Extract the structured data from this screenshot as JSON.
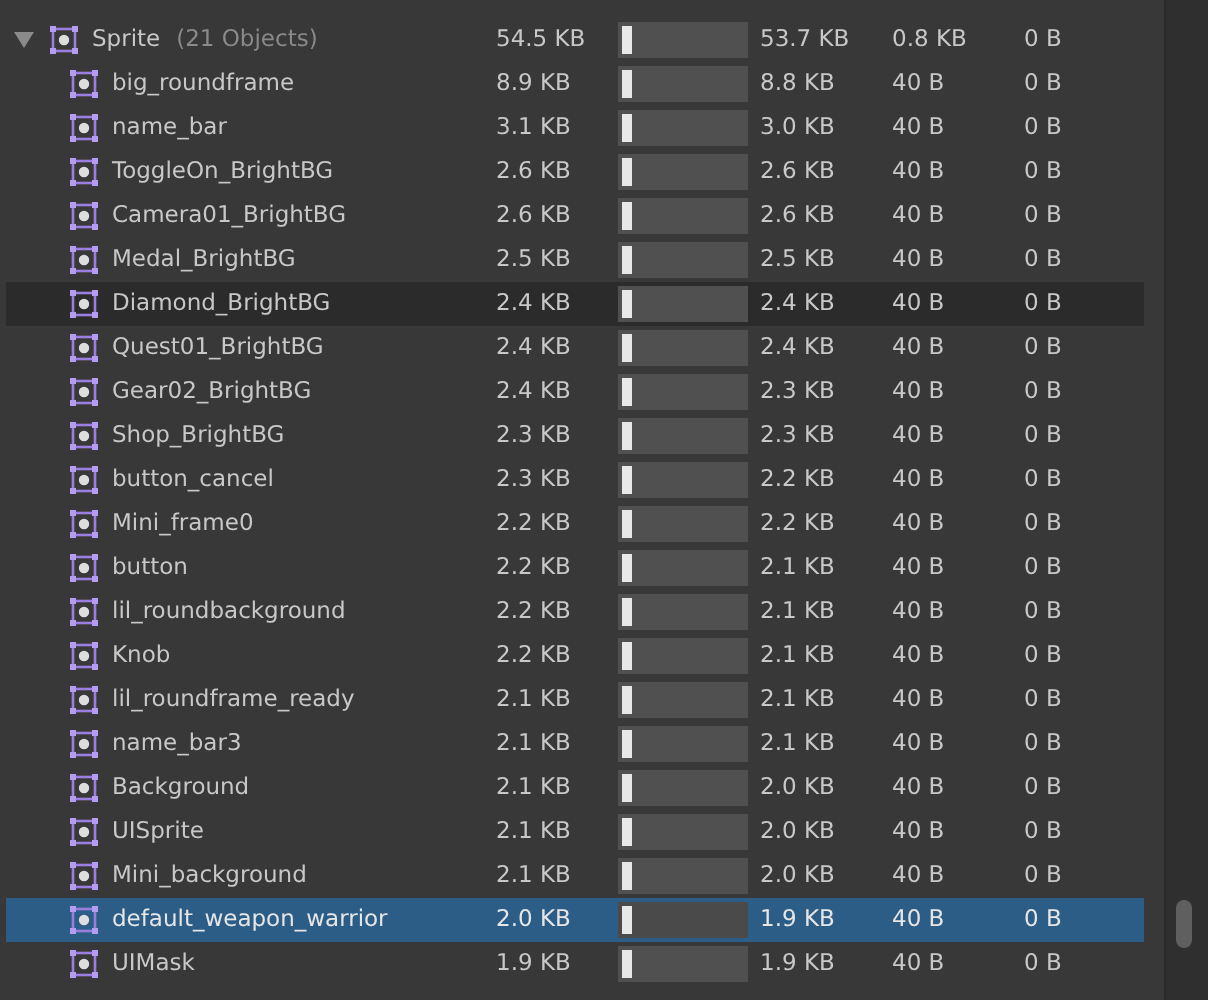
{
  "group": {
    "name": "Sprite",
    "count": "(21 Objects)",
    "expanded": true,
    "size": "54.5 KB",
    "level": 0.07,
    "col_3": "53.7 KB",
    "col_4": "0.8 KB",
    "col_5": "0 B"
  },
  "rows": [
    {
      "name": "big_roundframe",
      "size": "8.9 KB",
      "level": 0.07,
      "col_3": "8.8 KB",
      "col_4": "40 B",
      "col_5": "0 B",
      "selected": false,
      "hovered": false
    },
    {
      "name": "name_bar",
      "size": "3.1 KB",
      "level": 0.07,
      "col_3": "3.0 KB",
      "col_4": "40 B",
      "col_5": "0 B",
      "selected": false,
      "hovered": false
    },
    {
      "name": "ToggleOn_BrightBG",
      "size": "2.6 KB",
      "level": 0.07,
      "col_3": "2.6 KB",
      "col_4": "40 B",
      "col_5": "0 B",
      "selected": false,
      "hovered": false
    },
    {
      "name": "Camera01_BrightBG",
      "size": "2.6 KB",
      "level": 0.07,
      "col_3": "2.6 KB",
      "col_4": "40 B",
      "col_5": "0 B",
      "selected": false,
      "hovered": false
    },
    {
      "name": "Medal_BrightBG",
      "size": "2.5 KB",
      "level": 0.07,
      "col_3": "2.5 KB",
      "col_4": "40 B",
      "col_5": "0 B",
      "selected": false,
      "hovered": false
    },
    {
      "name": "Diamond_BrightBG",
      "size": "2.4 KB",
      "level": 0.07,
      "col_3": "2.4 KB",
      "col_4": "40 B",
      "col_5": "0 B",
      "selected": false,
      "hovered": true
    },
    {
      "name": "Quest01_BrightBG",
      "size": "2.4 KB",
      "level": 0.07,
      "col_3": "2.4 KB",
      "col_4": "40 B",
      "col_5": "0 B",
      "selected": false,
      "hovered": false
    },
    {
      "name": "Gear02_BrightBG",
      "size": "2.4 KB",
      "level": 0.07,
      "col_3": "2.3 KB",
      "col_4": "40 B",
      "col_5": "0 B",
      "selected": false,
      "hovered": false
    },
    {
      "name": "Shop_BrightBG",
      "size": "2.3 KB",
      "level": 0.07,
      "col_3": "2.3 KB",
      "col_4": "40 B",
      "col_5": "0 B",
      "selected": false,
      "hovered": false
    },
    {
      "name": "button_cancel",
      "size": "2.3 KB",
      "level": 0.07,
      "col_3": "2.2 KB",
      "col_4": "40 B",
      "col_5": "0 B",
      "selected": false,
      "hovered": false
    },
    {
      "name": "Mini_frame0",
      "size": "2.2 KB",
      "level": 0.07,
      "col_3": "2.2 KB",
      "col_4": "40 B",
      "col_5": "0 B",
      "selected": false,
      "hovered": false
    },
    {
      "name": "button",
      "size": "2.2 KB",
      "level": 0.07,
      "col_3": "2.1 KB",
      "col_4": "40 B",
      "col_5": "0 B",
      "selected": false,
      "hovered": false
    },
    {
      "name": "lil_roundbackground",
      "size": "2.2 KB",
      "level": 0.07,
      "col_3": "2.1 KB",
      "col_4": "40 B",
      "col_5": "0 B",
      "selected": false,
      "hovered": false
    },
    {
      "name": "Knob",
      "size": "2.2 KB",
      "level": 0.07,
      "col_3": "2.1 KB",
      "col_4": "40 B",
      "col_5": "0 B",
      "selected": false,
      "hovered": false
    },
    {
      "name": "lil_roundframe_ready",
      "size": "2.1 KB",
      "level": 0.07,
      "col_3": "2.1 KB",
      "col_4": "40 B",
      "col_5": "0 B",
      "selected": false,
      "hovered": false
    },
    {
      "name": "name_bar3",
      "size": "2.1 KB",
      "level": 0.07,
      "col_3": "2.1 KB",
      "col_4": "40 B",
      "col_5": "0 B",
      "selected": false,
      "hovered": false
    },
    {
      "name": "Background",
      "size": "2.1 KB",
      "level": 0.07,
      "col_3": "2.0 KB",
      "col_4": "40 B",
      "col_5": "0 B",
      "selected": false,
      "hovered": false
    },
    {
      "name": "UISprite",
      "size": "2.1 KB",
      "level": 0.07,
      "col_3": "2.0 KB",
      "col_4": "40 B",
      "col_5": "0 B",
      "selected": false,
      "hovered": false
    },
    {
      "name": "Mini_background",
      "size": "2.1 KB",
      "level": 0.07,
      "col_3": "2.0 KB",
      "col_4": "40 B",
      "col_5": "0 B",
      "selected": false,
      "hovered": false
    },
    {
      "name": "default_weapon_warrior",
      "size": "2.0 KB",
      "level": 0.07,
      "col_3": "1.9 KB",
      "col_4": "40 B",
      "col_5": "0 B",
      "selected": true,
      "hovered": false
    },
    {
      "name": "UIMask",
      "size": "1.9 KB",
      "level": 0.07,
      "col_3": "1.9 KB",
      "col_4": "40 B",
      "col_5": "0 B",
      "selected": false,
      "hovered": false
    }
  ]
}
